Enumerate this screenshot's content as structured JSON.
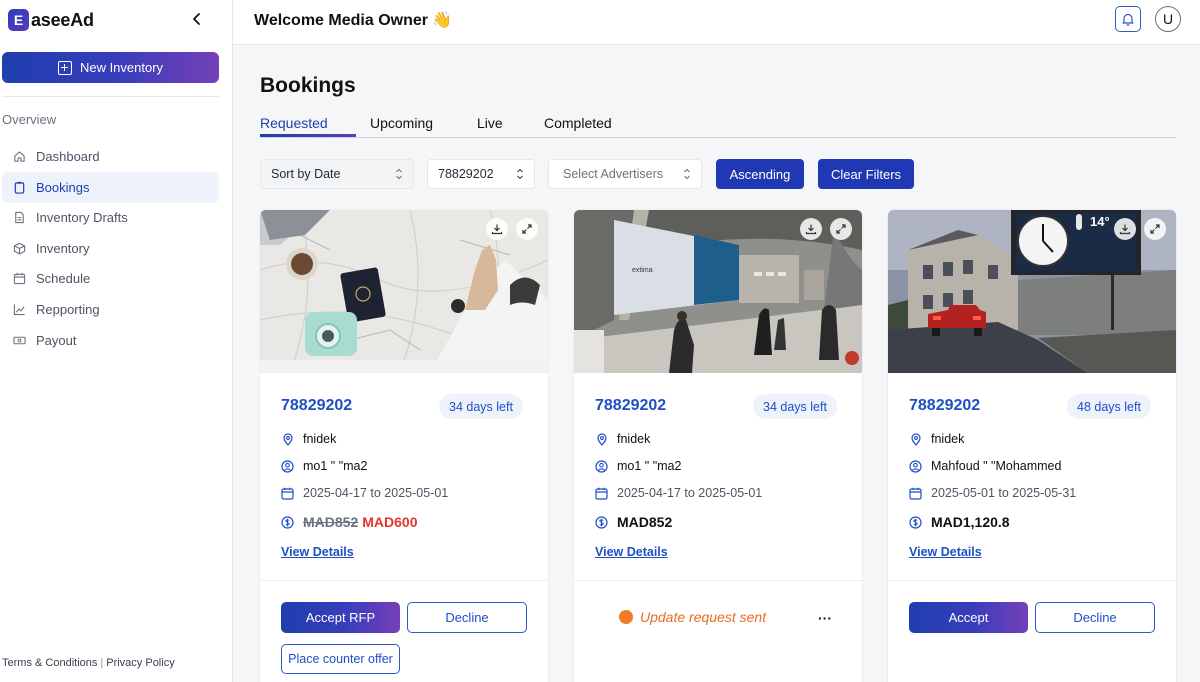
{
  "app": {
    "logo_letter": "E",
    "logo_text": "aseeAd"
  },
  "sidebar": {
    "new_inventory_label": "New Inventory",
    "section_label": "Overview",
    "items": [
      {
        "label": "Dashboard",
        "icon": "home-icon"
      },
      {
        "label": "Bookings",
        "icon": "clipboard-icon",
        "active": true
      },
      {
        "label": "Inventory Drafts",
        "icon": "document-icon"
      },
      {
        "label": "Inventory",
        "icon": "box-icon"
      },
      {
        "label": "Schedule",
        "icon": "calendar-icon"
      },
      {
        "label": "Repporting",
        "icon": "chart-icon"
      },
      {
        "label": "Payout",
        "icon": "money-icon"
      }
    ],
    "footer": {
      "terms": "Terms & Conditions",
      "separator": "|",
      "privacy": "Privacy Policy"
    }
  },
  "header": {
    "welcome": "Welcome Media Owner 👋",
    "avatar_initial": "U"
  },
  "main": {
    "title": "Bookings",
    "tabs": [
      {
        "label": "Requested",
        "active": true
      },
      {
        "label": "Upcoming"
      },
      {
        "label": "Live"
      },
      {
        "label": "Completed"
      }
    ],
    "filters": {
      "sort": "Sort by Date",
      "id": "78829202",
      "advertisers_placeholder": "Select Advertisers",
      "order_button": "Ascending",
      "clear_button": "Clear Filters"
    },
    "cards": [
      {
        "id": "78829202",
        "days_left": "34 days left",
        "location": "fnidek",
        "advertiser": "mo1 \" \"ma2",
        "dates": "2025-04-17 to 2025-05-01",
        "old_price": "MAD852",
        "new_price": "MAD600",
        "view_details": "View Details",
        "accept_label": "Accept RFP",
        "decline_label": "Decline",
        "counter_label": "Place counter offer"
      },
      {
        "id": "78829202",
        "days_left": "34 days left",
        "location": "fnidek",
        "advertiser": "mo1 \" \"ma2",
        "dates": "2025-04-17 to 2025-05-01",
        "price": "MAD852",
        "view_details": "View Details",
        "status": "Update request sent",
        "more": "···"
      },
      {
        "id": "78829202",
        "days_left": "48 days left",
        "location": "fnidek",
        "advertiser": "Mahfoud \" \"Mohammed",
        "dates": "2025-05-01 to 2025-05-31",
        "price": "MAD1,120.8",
        "view_details": "View Details",
        "accept_label": "Accept",
        "decline_label": "Decline"
      }
    ],
    "billboard": {
      "temperature": "14°",
      "brand": "extima"
    }
  },
  "colors": {
    "brand_blue": "#1e3fae",
    "brand_purple": "#7540b8",
    "link_blue": "#1e4fc4",
    "discount_red": "#e5342a",
    "status_orange": "#ea6a1f"
  }
}
